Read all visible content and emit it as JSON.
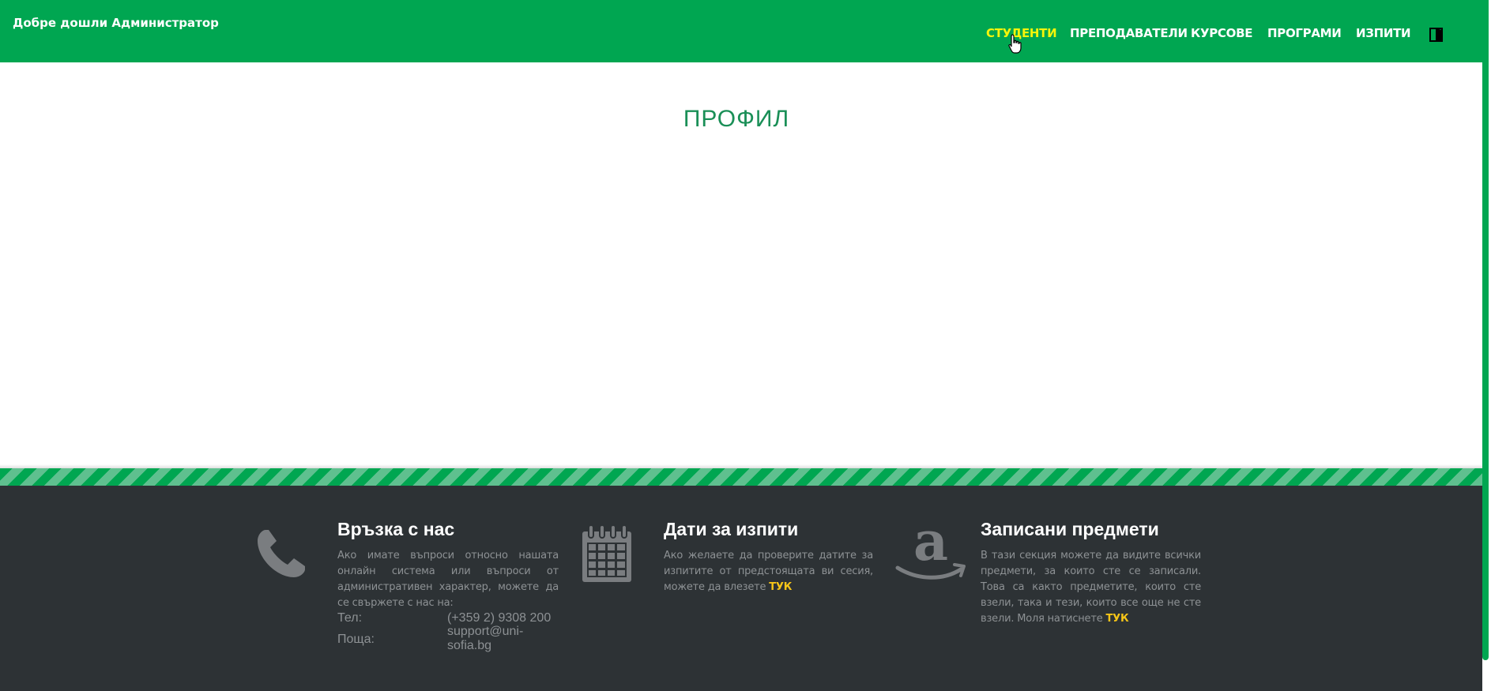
{
  "header": {
    "welcome": "Добре дошли Администратор",
    "nav": [
      {
        "label": "СТУДЕНТИ",
        "active": true
      },
      {
        "label": "ПРЕПОДАВАТЕЛИ",
        "active": false
      },
      {
        "label": "КУРСОВЕ",
        "active": false
      },
      {
        "label": "ПРОГРАМИ",
        "active": false
      },
      {
        "label": "ИЗПИТИ",
        "active": false
      }
    ],
    "logout_icon": "logout-door-icon"
  },
  "main": {
    "title": "ПРОФИЛ"
  },
  "footer": {
    "contact": {
      "icon": "phone-icon",
      "title": "Връзка с нас",
      "text": "Ако имате въпроси относно нашата онлайн система или въпроси от административен характер, можете да се свържете с нас на:",
      "phone_label": "Тел:",
      "phone_value": "(+359 2) 9308 200",
      "email_label": "Поща:",
      "email_value_line1": "support@uni-",
      "email_value_line2": "sofia.bg"
    },
    "exams": {
      "icon": "calendar-icon",
      "title": "Дати за изпити",
      "text": "Ако желаете да проверите датите за изпитите от предстоящата ви сесия, можете да влезете",
      "link": "ТУК"
    },
    "courses": {
      "icon": "amazon-icon",
      "title": "Записани предмети",
      "text": "В тази секция можете да видите всички предмети, за които сте се записали. Това са както предметите, които сте взели, така и тези, които все още не сте взели. Моля натиснете",
      "link": "ТУК"
    }
  },
  "colors": {
    "primary_green": "#00a651",
    "title_green": "#1a8f57",
    "active_nav": "#f5f50a",
    "footer_bg": "#2d3235",
    "link_yellow": "#f5c518"
  }
}
